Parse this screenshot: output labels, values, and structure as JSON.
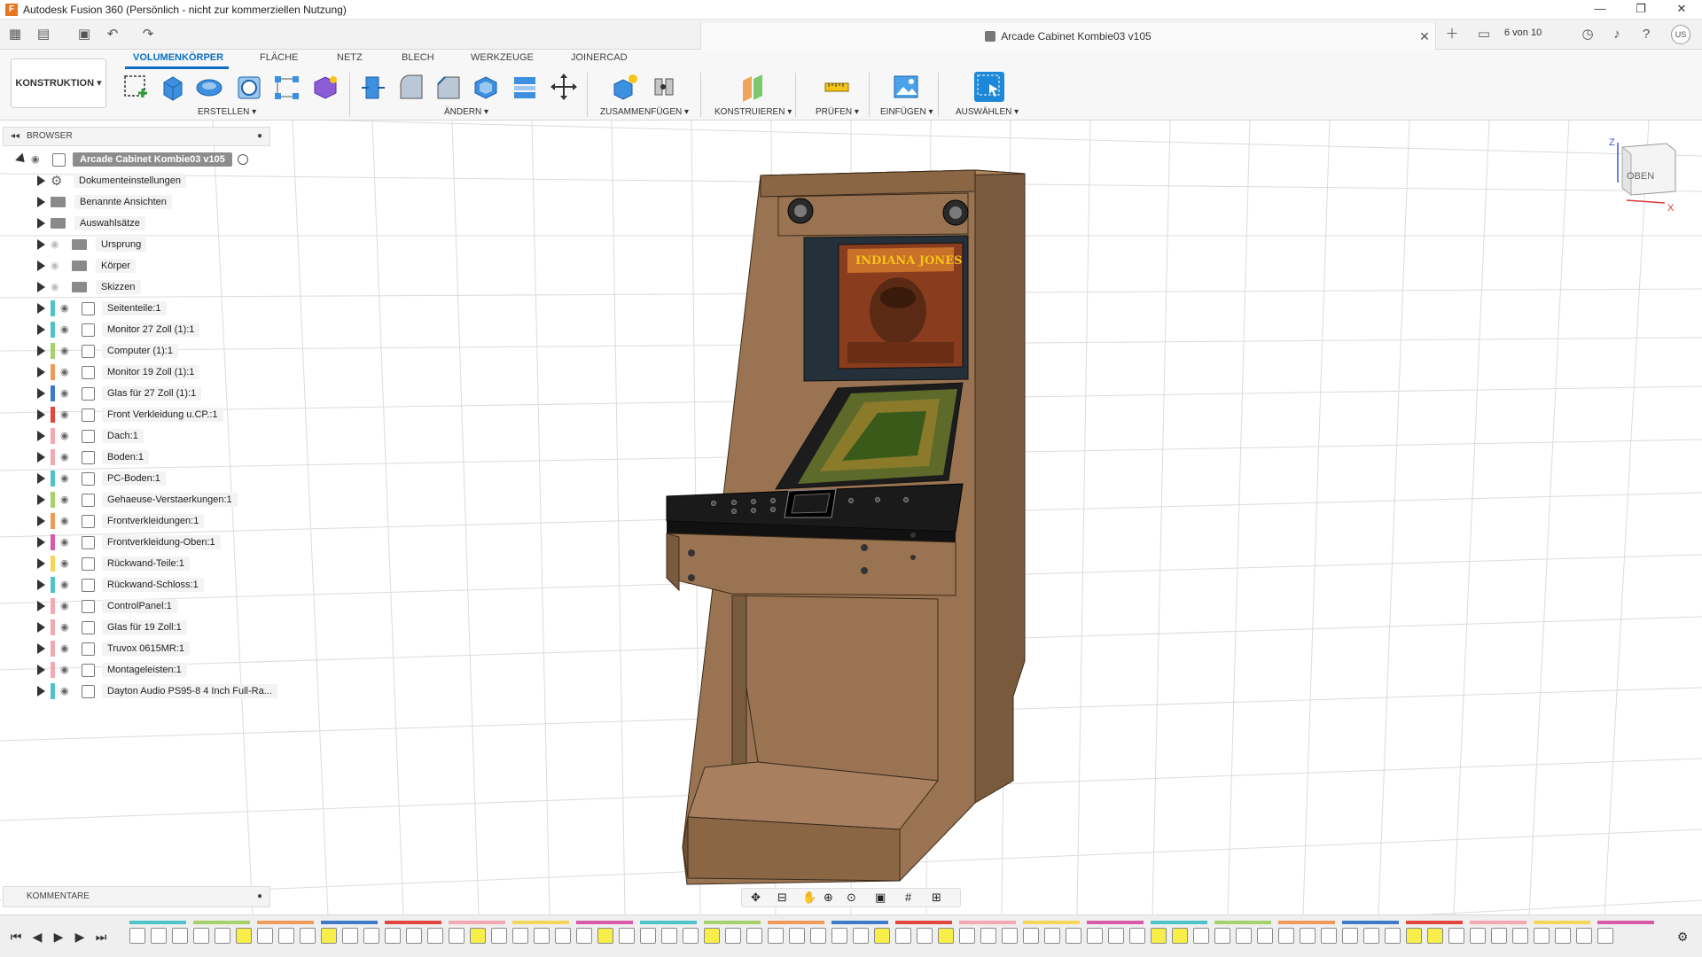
{
  "window": {
    "title": "Autodesk Fusion 360 (Persönlich - nicht zur kommerziellen Nutzung)",
    "app_icon": "F",
    "controls": [
      "—",
      "❐",
      "✕"
    ]
  },
  "appbar": {
    "document_tab": "Arcade Cabinet Kombie03 v105",
    "job_status": "6 von 10",
    "user_initials": "US"
  },
  "toolbar": {
    "workspace": "KONSTRUKTION ▾",
    "tabs": [
      "VOLUMENKÖRPER",
      "FLÄCHE",
      "NETZ",
      "BLECH",
      "WERKZEUGE",
      "JOINERCAD"
    ],
    "active_tab": "VOLUMENKÖRPER",
    "groups": [
      "ERSTELLEN ▾",
      "ÄNDERN ▾",
      "ZUSAMMENFÜGEN ▾",
      "KONSTRUIEREN ▾",
      "PRÜFEN ▾",
      "EINFÜGEN ▾",
      "AUSWÄHLEN ▾"
    ]
  },
  "browser": {
    "header": "BROWSER",
    "root": "Arcade Cabinet Kombie03 v105",
    "folders": [
      "Dokumenteinstellungen",
      "Benannte Ansichten",
      "Auswahlsätze",
      "Ursprung",
      "Körper",
      "Skizzen"
    ],
    "components": [
      {
        "label": "Seitenteile:1",
        "color": "#4fc3c9"
      },
      {
        "label": "Monitor 27 Zoll (1):1",
        "color": "#4fc3c9"
      },
      {
        "label": "Computer (1):1",
        "color": "#a6d26a"
      },
      {
        "label": "Monitor 19 Zoll  (1):1",
        "color": "#ee9a5a"
      },
      {
        "label": "Glas für 27 Zoll (1):1",
        "color": "#3f79c9"
      },
      {
        "label": "Front Verkleidung u.CP.:1",
        "color": "#e3463f"
      },
      {
        "label": "Dach:1",
        "color": "#f3a8b2"
      },
      {
        "label": "Boden:1",
        "color": "#f3a8b2"
      },
      {
        "label": "PC-Boden:1",
        "color": "#4fc3c9"
      },
      {
        "label": "Gehaeuse-Verstaerkungen:1",
        "color": "#a6d26a"
      },
      {
        "label": "Frontverkleidungen:1",
        "color": "#ee9a5a"
      },
      {
        "label": "Frontverkleidung-Oben:1",
        "color": "#d85aa8"
      },
      {
        "label": "Rückwand-Teile:1",
        "color": "#f3d65a"
      },
      {
        "label": "Rückwand-Schloss:1",
        "color": "#4fc3c9"
      },
      {
        "label": "ControlPanel:1",
        "color": "#f3a8b2"
      },
      {
        "label": "Glas für 19 Zoll:1",
        "color": "#f3a8b2"
      },
      {
        "label": "Truvox 0615MR:1",
        "color": "#f3a8b2"
      },
      {
        "label": "Montageleisten:1",
        "color": "#f3a8b2"
      },
      {
        "label": "Dayton Audio PS95-8 4 Inch Full-Ra...",
        "color": "#4fc3c9"
      }
    ],
    "comments": "KOMMENTARE"
  },
  "viewcube": {
    "face": "OBEN",
    "axis_z": "Z",
    "axis_x": "X"
  },
  "artwork": {
    "backglass_title": "INDIANA JONES"
  },
  "icons": {
    "grid": "grid-icon",
    "file": "file-icon",
    "save": "save-icon",
    "undo": "undo-icon",
    "redo": "redo-icon",
    "add_tab": "plus-icon",
    "notifications": "bell-icon",
    "help": "help-icon",
    "chat": "chat-icon",
    "clock": "clock-icon"
  },
  "colors": {
    "accent": "#0b6fc4",
    "cabinet_wood": "#9a7452",
    "cabinet_dark": "#6f5136",
    "grid_line": "#d9d9d9"
  }
}
